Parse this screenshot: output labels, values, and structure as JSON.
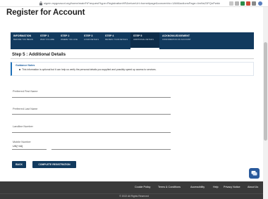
{
  "browser": {
    "url": "signin.mygovscot.org/home/mainFrFrequest?type=RegistrationHR&returnUrl=home#page&concentric=1AM&actionsPage=4mNs23FQnPwkkQFwpbMSZ6%Z5ALpYWpSSqGL"
  },
  "page": {
    "title": "Register for Account"
  },
  "steps": [
    {
      "name": "INFORMATION",
      "sub": "BEFORE YOU BEGIN",
      "active": false
    },
    {
      "name": "STEP 1",
      "sub": "WHO YOU ARE",
      "active": false
    },
    {
      "name": "STEP 2",
      "sub": "WHERE YOU LIVE",
      "active": false
    },
    {
      "name": "STEP 3",
      "sub": "LOGIN DETAILS",
      "active": false
    },
    {
      "name": "STEP 4",
      "sub": "REVIEW YOUR DETAILS",
      "active": false
    },
    {
      "name": "STEP 5",
      "sub": "ADDITIONAL DETAILS",
      "active": true
    },
    {
      "name": "ACKNOWLEDGEMENT",
      "sub": "CONFIRMATION OF ACCOUNT",
      "active": false
    }
  ],
  "section": {
    "heading": "Step 5 : Additional Details"
  },
  "guidance": {
    "title": "Guidance Notes",
    "text": "This information is optional but it can help us verify the personal details you supplied and possibly speed up access to services."
  },
  "form": {
    "preferred_first_name_label": "Preferred First Name",
    "preferred_last_name_label": "Preferred Last Name",
    "landline_label": "Landline Number",
    "mobile_label": "Mobile Number",
    "country_code": "UK(+44)"
  },
  "buttons": {
    "back": "BACK",
    "complete": "COMPLETE REGISTRATION"
  },
  "footer": {
    "links": [
      "Cookie Policy",
      "Terms & Conditions",
      "Accessibility",
      "Help",
      "Privacy Notice",
      "About Us"
    ],
    "copyright": "© 2022 All Rights Reserved"
  },
  "colors": {
    "navy": "#123a5e",
    "accent": "#1d70b8",
    "footer": "#3a3a3a"
  }
}
